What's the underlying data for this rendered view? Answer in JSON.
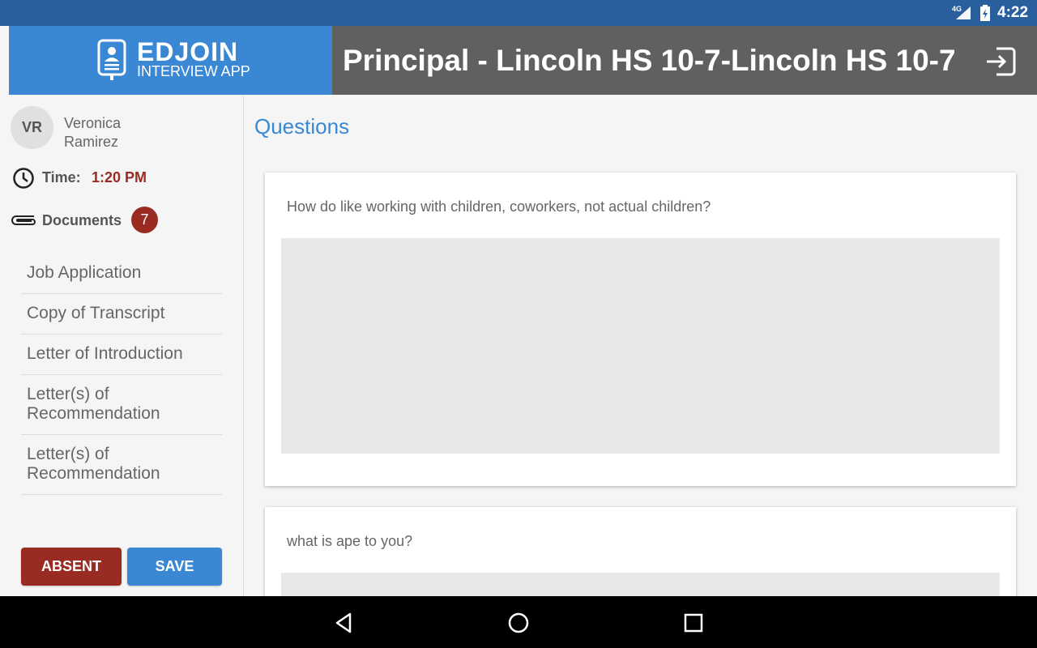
{
  "status_bar": {
    "network": "4G",
    "time": "4:22"
  },
  "header": {
    "logo_title": "EDJOIN",
    "logo_subtitle": "INTERVIEW APP",
    "page_title": "Principal - Lincoln HS 10-7-Lincoln HS 10-7",
    "exit_icon": "exit-icon"
  },
  "sidebar": {
    "candidate": {
      "initials": "VR",
      "first_name": "Veronica",
      "last_name": "Ramirez"
    },
    "time_label": "Time:",
    "time_value": "1:20 PM",
    "documents_label": "Documents",
    "documents_count": "7",
    "documents": [
      "Job Application",
      "Copy of Transcript",
      "Letter of Introduction",
      "Letter(s) of Recommendation",
      "Letter(s) of Recommendation"
    ],
    "absent_label": "ABSENT",
    "save_label": "SAVE"
  },
  "main": {
    "section_title": "Questions",
    "questions": [
      {
        "text": "How do like working with children, coworkers, not actual children?",
        "answer": ""
      },
      {
        "text": "what is ape to you?",
        "answer": ""
      }
    ]
  },
  "colors": {
    "status_bar": "#2a5f9e",
    "brand_blue": "#3a87d4",
    "header_gray": "#606060",
    "accent_red": "#992b22"
  }
}
